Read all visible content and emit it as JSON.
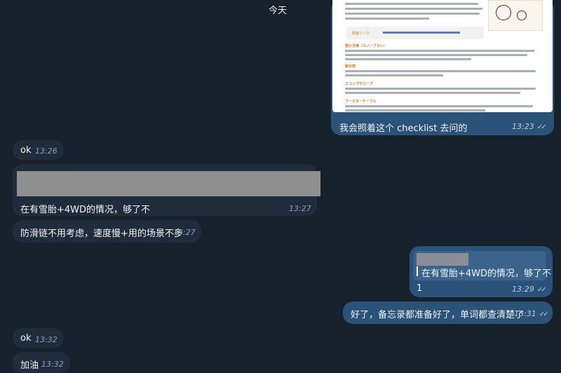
{
  "date_separator": "今天",
  "messages": [
    {
      "text": "我会照着这个 checklist 去问的",
      "time": "13:23",
      "ticks": "✓✓"
    },
    {
      "text": "ok",
      "time": "13:26"
    },
    {
      "text": "在有雪胎+4WD的情况，够了不",
      "time": "13:27"
    },
    {
      "text": "防滑链不用考虑，速度慢+用的场景不多",
      "time": "13:27"
    },
    {
      "quote": "在有雪胎+4WD的情况，够了不",
      "text": "1",
      "time": "13:29",
      "ticks": "✓✓"
    },
    {
      "text": "好了，备忘录都准备好了，单词都查清楚了",
      "time": "13:31",
      "ticks": "✓✓"
    },
    {
      "text": "ok",
      "time": "13:32"
    },
    {
      "text": "加油",
      "time": "13:32"
    }
  ],
  "image_preview": {
    "sections": [
      "関連リンク",
      "雪かき棒（スノーブラシ）",
      "解氷剤",
      "スコップやロープ",
      "ブースターケーブル"
    ],
    "link_title": "関連リンク"
  }
}
